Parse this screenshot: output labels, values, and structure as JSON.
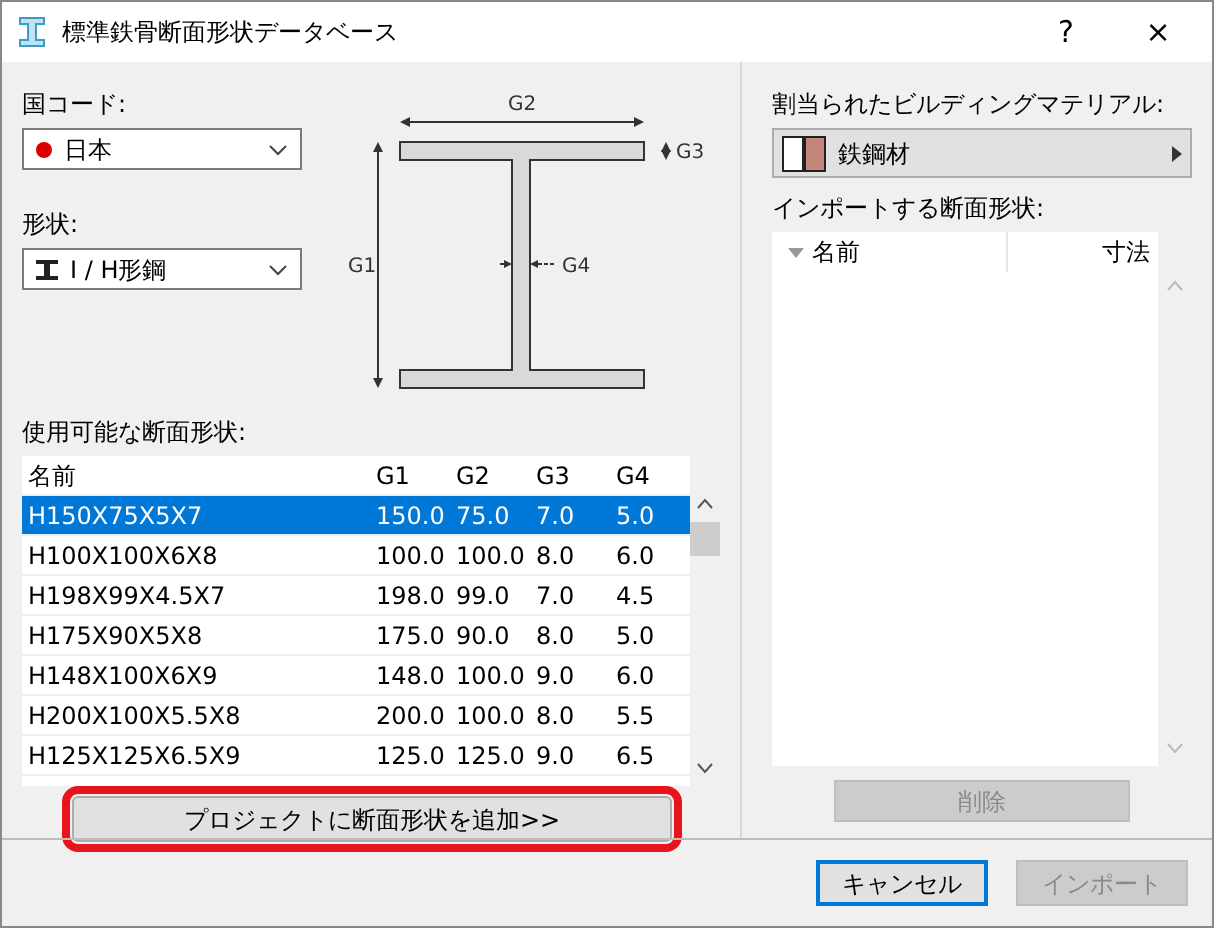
{
  "window": {
    "title": "標準鉄骨断面形状データベース",
    "help": "?",
    "close": "×"
  },
  "country": {
    "label": "国コード:",
    "value": "日本"
  },
  "shape": {
    "label": "形状:",
    "value": "I / H形鋼"
  },
  "diagram": {
    "labels": [
      "G2",
      "G3",
      "G1",
      "G4"
    ]
  },
  "available": {
    "label": "使用可能な断面形状:",
    "columns": [
      "名前",
      "G1",
      "G2",
      "G3",
      "G4"
    ],
    "rows": [
      {
        "cells": [
          "H150X75X5X7",
          "150.0",
          "75.0",
          "7.0",
          "5.0"
        ],
        "selected": true
      },
      {
        "cells": [
          "H100X100X6X8",
          "100.0",
          "100.0",
          "8.0",
          "6.0"
        ],
        "selected": false
      },
      {
        "cells": [
          "H198X99X4.5X7",
          "198.0",
          "99.0",
          "7.0",
          "4.5"
        ],
        "selected": false
      },
      {
        "cells": [
          "H175X90X5X8",
          "175.0",
          "90.0",
          "8.0",
          "5.0"
        ],
        "selected": false
      },
      {
        "cells": [
          "H148X100X6X9",
          "148.0",
          "100.0",
          "9.0",
          "6.0"
        ],
        "selected": false
      },
      {
        "cells": [
          "H200X100X5.5X8",
          "200.0",
          "100.0",
          "8.0",
          "5.5"
        ],
        "selected": false
      },
      {
        "cells": [
          "H125X125X6.5X9",
          "125.0",
          "125.0",
          "9.0",
          "6.5"
        ],
        "selected": false
      }
    ]
  },
  "add_button": {
    "label": "プロジェクトに断面形状を追加>>",
    "highlighted": true
  },
  "material": {
    "label": "割当られたビルディングマテリアル:",
    "value": "鉄鋼材"
  },
  "import_list": {
    "label": "インポートする断面形状:",
    "columns": [
      "名前",
      "寸法"
    ]
  },
  "delete_button": {
    "label": "削除",
    "disabled": true
  },
  "buttons": [
    {
      "label": "キャンセル",
      "default": true,
      "disabled": false
    },
    {
      "label": "インポート",
      "default": false,
      "disabled": true
    }
  ]
}
